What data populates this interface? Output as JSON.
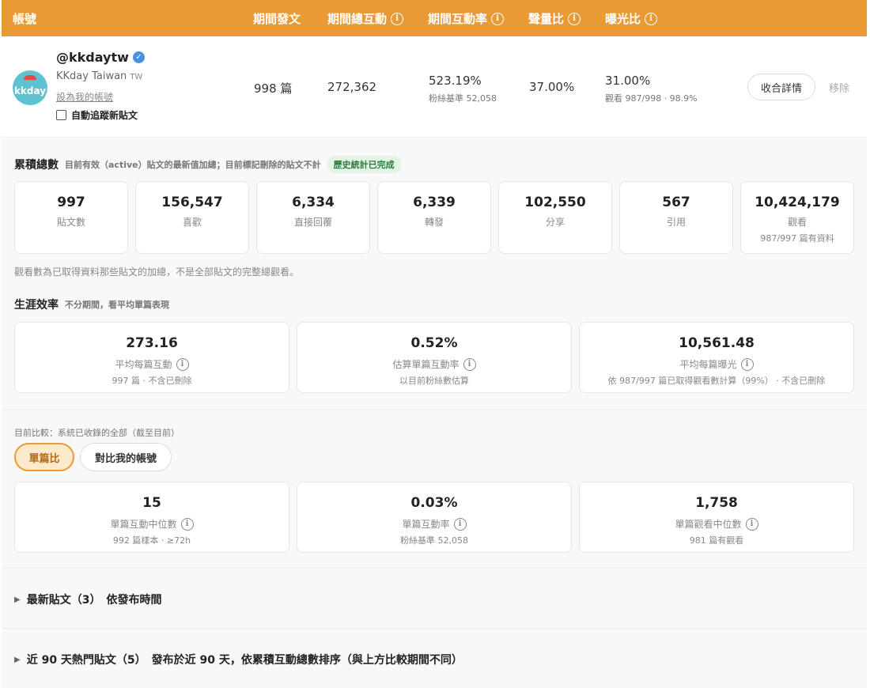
{
  "header": {
    "col_account": "帳號",
    "col_posts": "期間發文",
    "col_total_interactions": "期間總互動",
    "col_interaction_rate": "期間互動率",
    "col_share_of_voice": "聲量比",
    "col_exposure_ratio": "曝光比",
    "info_glyph": "i"
  },
  "account": {
    "handle": "@kkdaytw",
    "display_name": "KKday Taiwan",
    "region": "TW",
    "avatar_text": "kkday",
    "set_mine_link": "設為我的帳號",
    "auto_track_label": "自動追蹤新貼文",
    "auto_track_checked": false,
    "posts": "998 篇",
    "total_interactions": "272,362",
    "interaction_rate": "523.19%",
    "interaction_rate_sub": "粉絲基準 52,058",
    "share_of_voice": "37.00%",
    "exposure_ratio": "31.00%",
    "exposure_ratio_sub": "觀看 987/998 · 98.9%",
    "collapse_button": "收合詳情",
    "remove_button": "移除",
    "verified_glyph": "✓"
  },
  "cumulative": {
    "title": "累積總數",
    "desc": "目前有效（active）貼文的最新值加總；目前標記刪除的貼文不計",
    "badge": "歷史統計已完成",
    "stats": [
      {
        "value": "997",
        "label": "貼文數",
        "sub": ""
      },
      {
        "value": "156,547",
        "label": "喜歡",
        "sub": ""
      },
      {
        "value": "6,334",
        "label": "直接回覆",
        "sub": ""
      },
      {
        "value": "6,339",
        "label": "轉發",
        "sub": ""
      },
      {
        "value": "102,550",
        "label": "分享",
        "sub": ""
      },
      {
        "value": "567",
        "label": "引用",
        "sub": ""
      },
      {
        "value": "10,424,179",
        "label": "觀看",
        "sub": "987/997 篇有資料"
      }
    ],
    "note": "觀看數為已取得資料那些貼文的加總，不是全部貼文的完整總觀看。"
  },
  "career": {
    "title": "生涯效率",
    "desc": "不分期間，看平均單篇表現",
    "cards": [
      {
        "value": "273.16",
        "label": "平均每篇互動",
        "sub": "997 篇 · 不含已刪除"
      },
      {
        "value": "0.52%",
        "label": "估算單篇互動率",
        "sub": "以目前粉絲數估算"
      },
      {
        "value": "10,561.48",
        "label": "平均每篇曝光",
        "sub": "依 987/997 篇已取得觀看數計算（99%） · 不含已刪除"
      }
    ]
  },
  "compare": {
    "label": "目前比較：系統已收錄的全部（截至目前）",
    "tab_single": "單篇比",
    "tab_mine": "對比我的帳號",
    "cards": [
      {
        "value": "15",
        "label": "單篇互動中位數",
        "sub": "992 篇樣本 · ≥72h"
      },
      {
        "value": "0.03%",
        "label": "單篇互動率",
        "sub": "粉絲基準 52,058"
      },
      {
        "value": "1,758",
        "label": "單篇觀看中位數",
        "sub": "981 篇有觀看"
      }
    ]
  },
  "sections": {
    "latest_posts": "最新貼文（3）　依發布時間",
    "hot_posts": "近 90 天熱門貼文（5）　發布於近 90 天，依累積互動總數排序（與上方比較期間不同）",
    "caret_glyph": "▶"
  },
  "colors": {
    "accent": "#e99a35",
    "verified": "#4a90e2",
    "badge_green": "#2d7a3e"
  }
}
